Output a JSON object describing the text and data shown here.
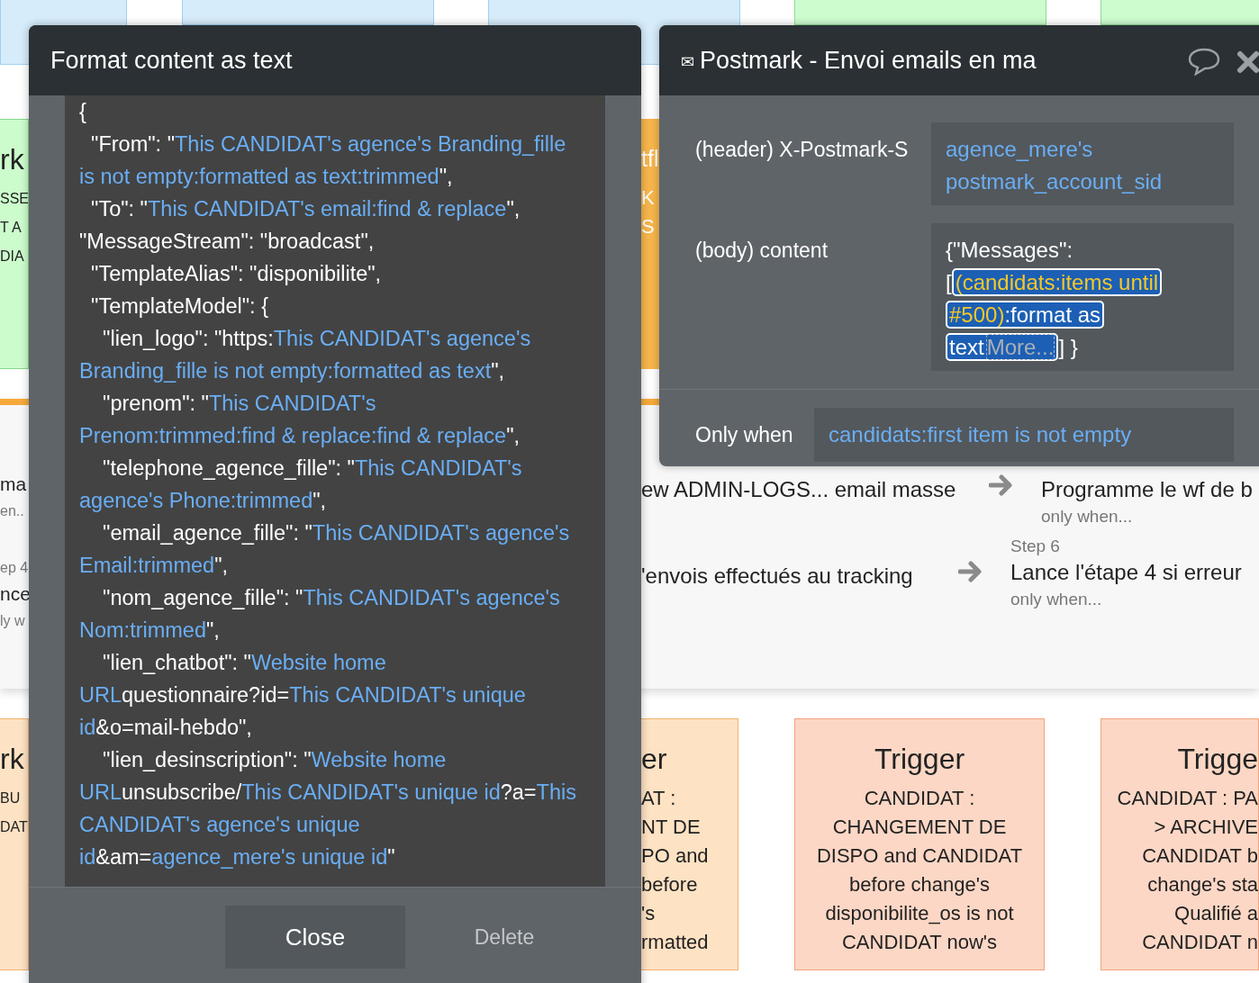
{
  "background_cards": [
    {
      "kind": "green",
      "title": "rk",
      "lines": [
        "SSE",
        "T A",
        "DIA"
      ]
    },
    {
      "kind": "orange",
      "title": "tfl",
      "lines": [
        "K",
        "S"
      ]
    },
    {
      "kind": "peach",
      "title": "rk",
      "lines": [
        "BU",
        "DAT"
      ]
    },
    {
      "kind": "peach",
      "title": "er",
      "lines": [
        "AT :",
        "NT DE",
        "PO and",
        "before",
        "'s",
        "rmatted"
      ]
    },
    {
      "kind": "salmon",
      "title": "Trigger",
      "lines": [
        "CANDIDAT :",
        "CHANGEMENT DE",
        "DISPO and CANDIDAT",
        "before change's",
        "disponibilite_os is not",
        "CANDIDAT now's"
      ]
    },
    {
      "kind": "salmon",
      "title": "Trigge",
      "lines": [
        "CANDIDAT : PA",
        "> ARCHIVE",
        "CANDIDAT b",
        "change's sta",
        "Qualifié a",
        "CANDIDAT n"
      ]
    }
  ],
  "workflow_steps": {
    "fragments": [
      {
        "title": "ma",
        "condition": "en.."
      },
      {
        "step": "ep 4",
        "title": "nce",
        "condition": "ly w"
      }
    ],
    "rows": [
      {
        "previous": "ew ADMIN-LOGS... email masse",
        "next": {
          "title": "Programme le wf de b",
          "condition": "only when..."
        }
      },
      {
        "previous": "'envois effectués au tracking",
        "next": {
          "step": "Step 6",
          "title": "Lance l'étape 4 si erreur",
          "condition": "only when..."
        }
      }
    ]
  },
  "format_dialog": {
    "title": "Format content as text",
    "lines": [
      [
        {
          "text": "{",
          "kind": "plain"
        }
      ],
      [
        {
          "text": "  \"From\": \"",
          "kind": "plain"
        },
        {
          "text": "This CANDIDAT's agence's Branding_fille",
          "kind": "dynamic"
        }
      ],
      [
        {
          "text": "is not empty:formatted as text:trimmed",
          "kind": "dynamic"
        },
        {
          "text": "\",",
          "kind": "plain"
        }
      ],
      [
        {
          "text": "  \"To\": \"",
          "kind": "plain"
        },
        {
          "text": "This CANDIDAT's email:find & replace",
          "kind": "dynamic"
        },
        {
          "text": "\",",
          "kind": "plain"
        }
      ],
      [
        {
          "text": "\"MessageStream\": \"broadcast\",",
          "kind": "plain"
        }
      ],
      [
        {
          "text": "  \"TemplateAlias\": \"disponibilite\",",
          "kind": "plain"
        }
      ],
      [
        {
          "text": "  \"TemplateModel\": {",
          "kind": "plain"
        }
      ],
      [
        {
          "text": "    \"lien_logo\": \"https:",
          "kind": "plain"
        },
        {
          "text": "This CANDIDAT's agence's",
          "kind": "dynamic"
        }
      ],
      [
        {
          "text": "Branding_fille is not empty:formatted as text",
          "kind": "dynamic"
        },
        {
          "text": "\",",
          "kind": "plain"
        }
      ],
      [
        {
          "text": "    \"prenom\": \"",
          "kind": "plain"
        },
        {
          "text": "This CANDIDAT's",
          "kind": "dynamic"
        }
      ],
      [
        {
          "text": "Prenom:trimmed:find & replace:find & replace",
          "kind": "dynamic"
        },
        {
          "text": "\",",
          "kind": "plain"
        }
      ],
      [
        {
          "text": "    \"telephone_agence_fille\": \"",
          "kind": "plain"
        },
        {
          "text": "This CANDIDAT's",
          "kind": "dynamic"
        }
      ],
      [
        {
          "text": "agence's Phone:trimmed",
          "kind": "dynamic"
        },
        {
          "text": "\",",
          "kind": "plain"
        }
      ],
      [
        {
          "text": "    \"email_agence_fille\": \"",
          "kind": "plain"
        },
        {
          "text": "This CANDIDAT's agence's",
          "kind": "dynamic"
        }
      ],
      [
        {
          "text": "Email:trimmed",
          "kind": "dynamic"
        },
        {
          "text": "\",",
          "kind": "plain"
        }
      ],
      [
        {
          "text": "    \"nom_agence_fille\": \"",
          "kind": "plain"
        },
        {
          "text": "This CANDIDAT's agence's",
          "kind": "dynamic"
        }
      ],
      [
        {
          "text": "Nom:trimmed",
          "kind": "dynamic"
        },
        {
          "text": "\",",
          "kind": "plain"
        }
      ],
      [
        {
          "text": "    \"lien_chatbot\": \"",
          "kind": "plain"
        },
        {
          "text": "Website home",
          "kind": "dynamic"
        }
      ],
      [
        {
          "text": "URL",
          "kind": "dynamic"
        },
        {
          "text": "questionnaire?id=",
          "kind": "plain"
        },
        {
          "text": "This CANDIDAT's unique",
          "kind": "dynamic"
        }
      ],
      [
        {
          "text": "id",
          "kind": "dynamic"
        },
        {
          "text": "&o=mail-hebdo\",",
          "kind": "plain"
        }
      ],
      [
        {
          "text": "    \"lien_desinscription\": \"",
          "kind": "plain"
        },
        {
          "text": "Website home",
          "kind": "dynamic"
        }
      ],
      [
        {
          "text": "URL",
          "kind": "dynamic"
        },
        {
          "text": "unsubscribe/",
          "kind": "plain"
        },
        {
          "text": "This CANDIDAT's unique id",
          "kind": "dynamic"
        },
        {
          "text": "?a=",
          "kind": "plain"
        },
        {
          "text": "This",
          "kind": "dynamic"
        }
      ],
      [
        {
          "text": "CANDIDAT's agence's unique",
          "kind": "dynamic"
        }
      ],
      [
        {
          "text": "id",
          "kind": "dynamic"
        },
        {
          "text": "&am=",
          "kind": "plain"
        },
        {
          "text": "agence_mere's unique id",
          "kind": "dynamic"
        },
        {
          "text": "\"",
          "kind": "plain"
        }
      ]
    ],
    "buttons": [
      {
        "label": "Close",
        "kind": "primary"
      },
      {
        "label": "Delete",
        "kind": "muted"
      }
    ]
  },
  "action_dialog": {
    "icon": "✉",
    "title": "Postmark - Envoi emails en ma",
    "fields": [
      {
        "label": "(header) X-Postmark-S",
        "kind": "dynamic",
        "value": "agence_mere's postmark_account_sid"
      },
      {
        "label": "(body) content",
        "kind": "expression",
        "first_line": "{\"Messages\":",
        "open": "[",
        "chip": [
          {
            "text": "(candidats:items until #500)",
            "kind": "highlight"
          },
          {
            "text": ":format as text",
            "kind": "plain"
          },
          {
            "text": "More...",
            "kind": "more"
          }
        ],
        "close": "] }"
      }
    ],
    "condition": {
      "label": "Only when",
      "value": "candidats:first item is not empty"
    }
  }
}
